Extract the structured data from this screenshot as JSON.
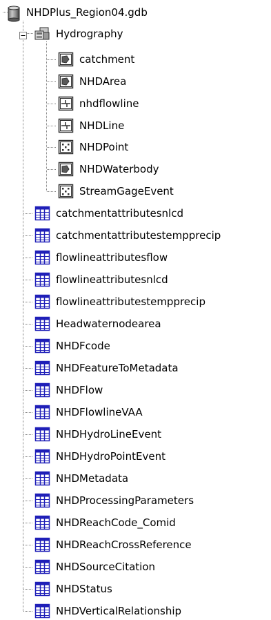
{
  "tree": {
    "root": {
      "label": "NHDPlus_Region04.gdb",
      "icon": "geodatabase-cylinder-icon"
    },
    "dataset": {
      "label": "Hydrography",
      "icon": "feature-dataset-icon",
      "expanded_symbol": "−"
    },
    "feature_classes": [
      {
        "label": "catchment",
        "icon": "polygon-feature-class-icon"
      },
      {
        "label": "NHDArea",
        "icon": "polygon-feature-class-icon"
      },
      {
        "label": "nhdflowline",
        "icon": "line-feature-class-icon"
      },
      {
        "label": "NHDLine",
        "icon": "line-feature-class-icon"
      },
      {
        "label": "NHDPoint",
        "icon": "point-feature-class-icon"
      },
      {
        "label": "NHDWaterbody",
        "icon": "polygon-feature-class-icon"
      },
      {
        "label": "StreamGageEvent",
        "icon": "point-feature-class-icon"
      }
    ],
    "tables": [
      {
        "label": "catchmentattributesnlcd",
        "icon": "table-icon"
      },
      {
        "label": "catchmentattributestempprecip",
        "icon": "table-icon"
      },
      {
        "label": "flowlineattributesflow",
        "icon": "table-icon"
      },
      {
        "label": "flowlineattributesnlcd",
        "icon": "table-icon"
      },
      {
        "label": "flowlineattributestempprecip",
        "icon": "table-icon"
      },
      {
        "label": "Headwaternodearea",
        "icon": "table-icon"
      },
      {
        "label": "NHDFcode",
        "icon": "table-icon"
      },
      {
        "label": "NHDFeatureToMetadata",
        "icon": "table-icon"
      },
      {
        "label": "NHDFlow",
        "icon": "table-icon"
      },
      {
        "label": "NHDFlowlineVAA",
        "icon": "table-icon"
      },
      {
        "label": "NHDHydroLineEvent",
        "icon": "table-icon"
      },
      {
        "label": "NHDHydroPointEvent",
        "icon": "table-icon"
      },
      {
        "label": "NHDMetadata",
        "icon": "table-icon"
      },
      {
        "label": "NHDProcessingParameters",
        "icon": "table-icon"
      },
      {
        "label": "NHDReachCode_Comid",
        "icon": "table-icon"
      },
      {
        "label": "NHDReachCrossReference",
        "icon": "table-icon"
      },
      {
        "label": "NHDSourceCitation",
        "icon": "table-icon"
      },
      {
        "label": "NHDStatus",
        "icon": "table-icon"
      },
      {
        "label": "NHDVerticalRelationship",
        "icon": "table-icon"
      }
    ]
  },
  "colors": {
    "tree_line": "#808080",
    "table_blue": "#1f1fb8",
    "icon_dark": "#303030"
  }
}
